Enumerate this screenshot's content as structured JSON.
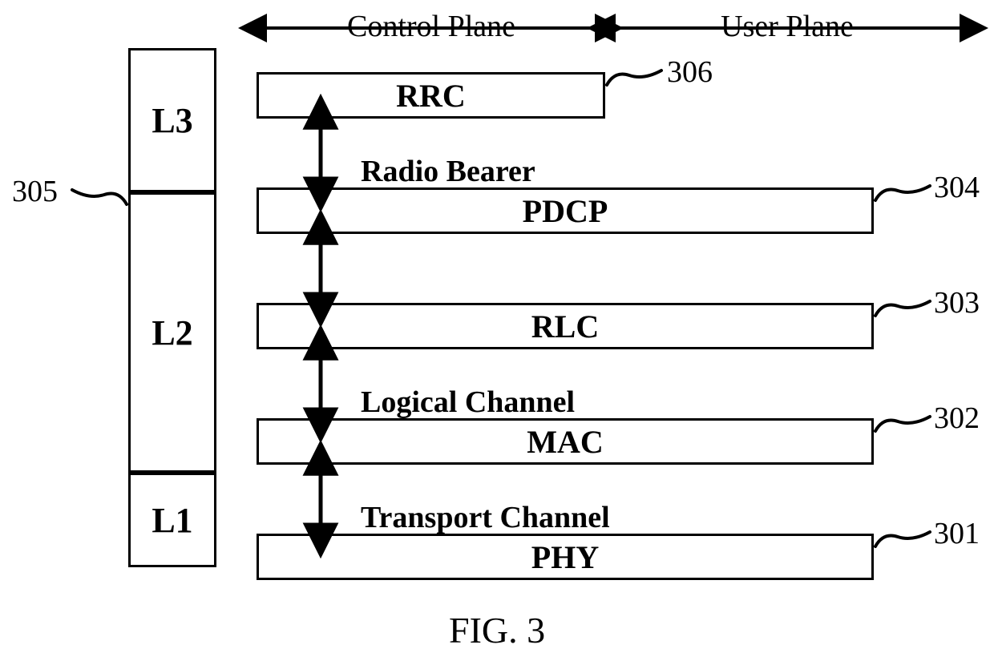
{
  "figure_caption": "FIG. 3",
  "planes": {
    "control": "Control Plane",
    "user": "User Plane"
  },
  "layer_column": {
    "l3": "L3",
    "l2": "L2",
    "l1": "L1"
  },
  "protocol_boxes": {
    "rrc": {
      "label": "RRC",
      "ref": "306"
    },
    "pdcp": {
      "label": "PDCP",
      "ref": "304",
      "channel_above": "Radio Bearer"
    },
    "rlc": {
      "label": "RLC",
      "ref": "303"
    },
    "mac": {
      "label": "MAC",
      "ref": "302",
      "channel_above": "Logical Channel"
    },
    "phy": {
      "label": "PHY",
      "ref": "301",
      "channel_above": "Transport Channel"
    }
  },
  "side_ref": "305"
}
